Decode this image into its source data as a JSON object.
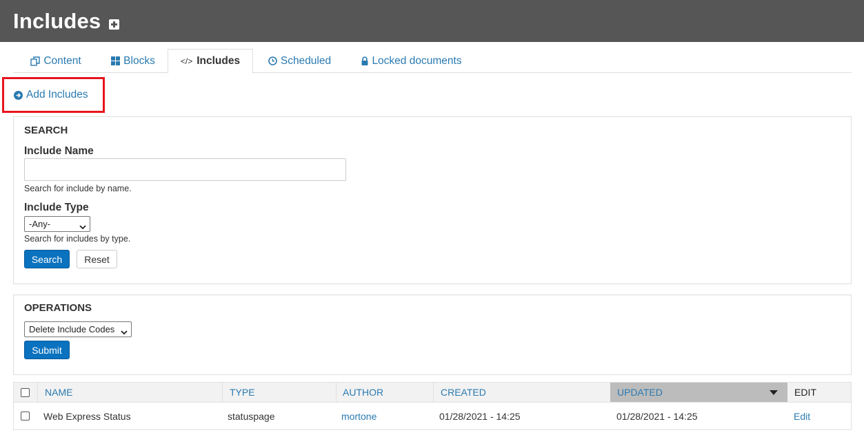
{
  "header": {
    "title": "Includes"
  },
  "tabs": [
    {
      "label": "Content",
      "icon": "copy-icon",
      "active": false
    },
    {
      "label": "Blocks",
      "icon": "grid-icon",
      "active": false
    },
    {
      "label": "Includes",
      "icon": "code-icon",
      "active": true
    },
    {
      "label": "Scheduled",
      "icon": "clock-icon",
      "active": false
    },
    {
      "label": "Locked documents",
      "icon": "lock-icon",
      "active": false
    }
  ],
  "add_link": {
    "label": "Add Includes"
  },
  "search": {
    "title": "SEARCH",
    "name_label": "Include Name",
    "name_value": "",
    "name_help": "Search for include by name.",
    "type_label": "Include Type",
    "type_selected": "-Any-",
    "type_help": "Search for includes by type.",
    "search_button": "Search",
    "reset_button": "Reset"
  },
  "operations": {
    "title": "OPERATIONS",
    "selected": "Delete Include Codes",
    "submit_button": "Submit"
  },
  "table": {
    "columns": [
      "NAME",
      "TYPE",
      "AUTHOR",
      "CREATED",
      "UPDATED",
      "EDIT"
    ],
    "sorted_column": "UPDATED",
    "rows": [
      {
        "name": "Web Express Status",
        "type": "statuspage",
        "author": "mortone",
        "created": "01/28/2021 - 14:25",
        "updated": "01/28/2021 - 14:25",
        "edit": "Edit"
      }
    ]
  },
  "colors": {
    "header_bg": "#565656",
    "link": "#2a7ab0",
    "primary_button": "#0a72bf",
    "highlight_border": "#e8141c",
    "sorted_header": "#bcbcbc"
  }
}
